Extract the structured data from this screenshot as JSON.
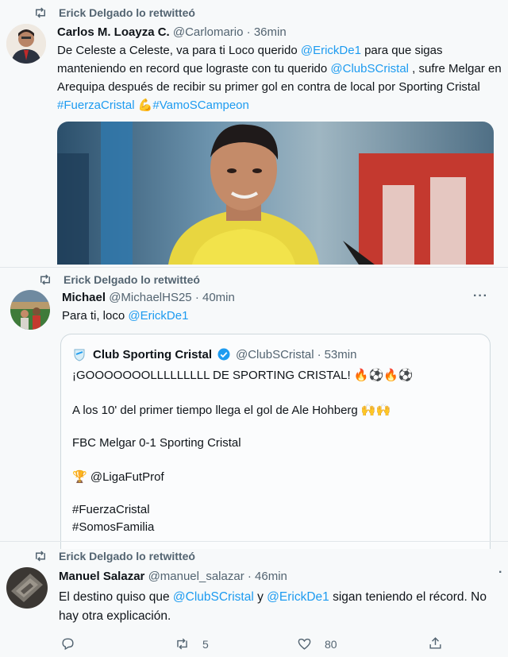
{
  "tweet1": {
    "retweet_label": "Erick Delgado lo retwitteó",
    "name": "Carlos M. Loayza C.",
    "handle": "@Carlomario",
    "time": "36min",
    "text_1": "De Celeste a Celeste, va para ti Loco querido ",
    "mention_1": "@ErickDe1",
    "text_2": " para que sigas manteniendo en record que lograste con tu querido ",
    "mention_2": "@ClubSCristal",
    "text_3": " , sufre Melgar en Arequipa después de recibir su primer gol en contra de local por Sporting Cristal ",
    "hashtag_1": "#FuerzaCristal",
    "emoji": "💪",
    "hashtag_2": "#VamoSCampeon"
  },
  "tweet2": {
    "retweet_label": "Erick Delgado lo retwitteó",
    "name": "Michael",
    "handle": "@MichaelHS25",
    "time": "40min",
    "more": "···",
    "text": "Para ti, loco ",
    "mention": "@ErickDe1",
    "quote": {
      "name": "Club Sporting Cristal",
      "handle": "@ClubSCristal",
      "time": "53min",
      "line_1": "¡GOOOOOOOLLLLLLLLL DE SPORTING CRISTAL! 🔥⚽🔥⚽",
      "line_2": "A los 10' del primer tiempo llega el gol de Ale Hohberg 🙌🙌",
      "line_3": "FBC Melgar 0-1 Sporting Cristal",
      "line_4": "🏆 @LigaFutProf",
      "line_5": "#FuerzaCristal",
      "line_6": "#SomosFamilia"
    }
  },
  "tweet3": {
    "retweet_label": "Erick Delgado lo retwitteó",
    "name": "Manuel Salazar",
    "handle": "@manuel_salazar",
    "time": "46min",
    "text_1": "El destino quiso que  ",
    "mention_1": "@ClubSCristal",
    "text_2": " y ",
    "mention_2": "@ErickDe1",
    "text_3": " sigan teniendo el récord. No hay otra explicación.",
    "retweets": "5",
    "likes": "80"
  },
  "colors": {
    "link": "#1d9bf0",
    "secondary_text": "#536471",
    "verified": "#1d9bf0"
  }
}
